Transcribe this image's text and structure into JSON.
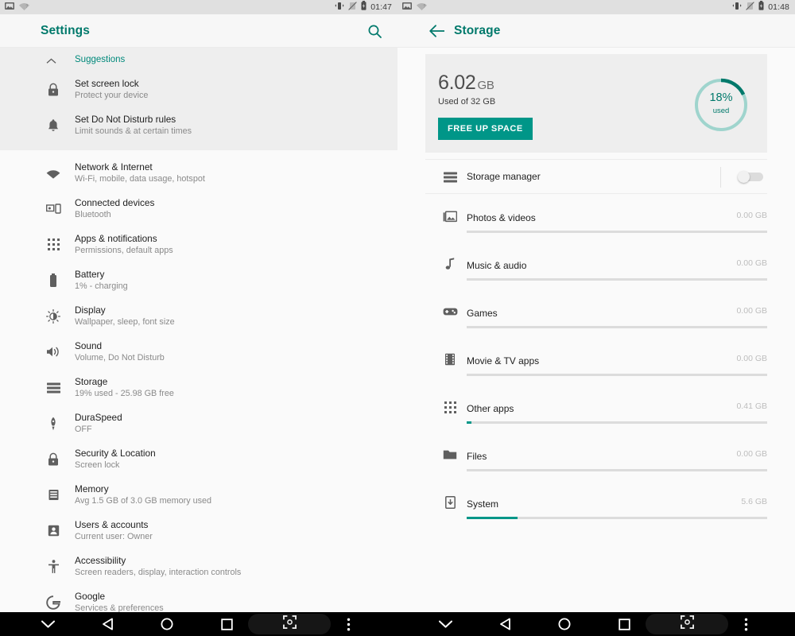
{
  "status_bar": {
    "left_icons": [
      "screenshot-icon",
      "wifi-question-icon"
    ],
    "right_icons": [
      "rotation-lock-icon",
      "mute-icon",
      "battery-icon"
    ],
    "time_left_pane": "01:47",
    "time_right_pane": "01:48"
  },
  "left_pane": {
    "title": "Settings",
    "search_icon": "search-icon",
    "suggestions": {
      "header": "Suggestions",
      "collapse_icon": "chevron-up-icon",
      "items": [
        {
          "icon": "lock-icon",
          "title": "Set screen lock",
          "subtitle": "Protect your device"
        },
        {
          "icon": "bell-icon",
          "title": "Set Do Not Disturb rules",
          "subtitle": "Limit sounds & at certain times"
        }
      ]
    },
    "items": [
      {
        "icon": "wifi-icon",
        "title": "Network & Internet",
        "subtitle": "Wi-Fi, mobile, data usage, hotspot"
      },
      {
        "icon": "connected-devices-icon",
        "title": "Connected devices",
        "subtitle": "Bluetooth"
      },
      {
        "icon": "apps-grid-icon",
        "title": "Apps & notifications",
        "subtitle": "Permissions, default apps"
      },
      {
        "icon": "battery-icon",
        "title": "Battery",
        "subtitle": "1% - charging"
      },
      {
        "icon": "brightness-icon",
        "title": "Display",
        "subtitle": "Wallpaper, sleep, font size"
      },
      {
        "icon": "volume-icon",
        "title": "Sound",
        "subtitle": "Volume, Do Not Disturb"
      },
      {
        "icon": "storage-icon",
        "title": "Storage",
        "subtitle": "19% used - 25.98 GB free"
      },
      {
        "icon": "rocket-icon",
        "title": "DuraSpeed",
        "subtitle": "OFF"
      },
      {
        "icon": "lock-icon",
        "title": "Security & Location",
        "subtitle": "Screen lock"
      },
      {
        "icon": "memory-icon",
        "title": "Memory",
        "subtitle": "Avg 1.5 GB of 3.0 GB memory used"
      },
      {
        "icon": "person-icon",
        "title": "Users & accounts",
        "subtitle": "Current user: Owner"
      },
      {
        "icon": "accessibility-icon",
        "title": "Accessibility",
        "subtitle": "Screen readers, display, interaction controls"
      },
      {
        "icon": "google-g-icon",
        "title": "Google",
        "subtitle": "Services & preferences"
      }
    ]
  },
  "right_pane": {
    "title": "Storage",
    "back_icon": "arrow-back-icon",
    "summary": {
      "used_value": "6.02",
      "used_unit": "GB",
      "caption": "Used of 32 GB",
      "free_button": "FREE UP SPACE",
      "donut_percent_label": "18%",
      "donut_sub_label": "used",
      "donut_percent": 18,
      "accent_color": "#009688",
      "track_color": "#9fd4cd"
    },
    "storage_manager": {
      "icon": "storage-manager-icon",
      "label": "Storage manager",
      "toggle_on": false
    },
    "categories": [
      {
        "icon": "photo-icon",
        "label": "Photos & videos",
        "size": "0.00 GB",
        "fill_percent": 0
      },
      {
        "icon": "music-icon",
        "label": "Music & audio",
        "size": "0.00 GB",
        "fill_percent": 0
      },
      {
        "icon": "gamepad-icon",
        "label": "Games",
        "size": "0.00 GB",
        "fill_percent": 0
      },
      {
        "icon": "film-icon",
        "label": "Movie & TV apps",
        "size": "0.00 GB",
        "fill_percent": 0
      },
      {
        "icon": "apps-grid-icon",
        "label": "Other apps",
        "size": "0.41 GB",
        "fill_percent": 1.5
      },
      {
        "icon": "folder-icon",
        "label": "Files",
        "size": "0.00 GB",
        "fill_percent": 0
      },
      {
        "icon": "system-icon",
        "label": "System",
        "size": "5.6 GB",
        "fill_percent": 17
      }
    ]
  },
  "nav_bar": {
    "buttons": [
      "chevron-down-icon",
      "back-triangle-icon",
      "home-circle-icon",
      "recents-square-icon",
      "screenshot-icon",
      "overflow-menu-icon"
    ]
  }
}
